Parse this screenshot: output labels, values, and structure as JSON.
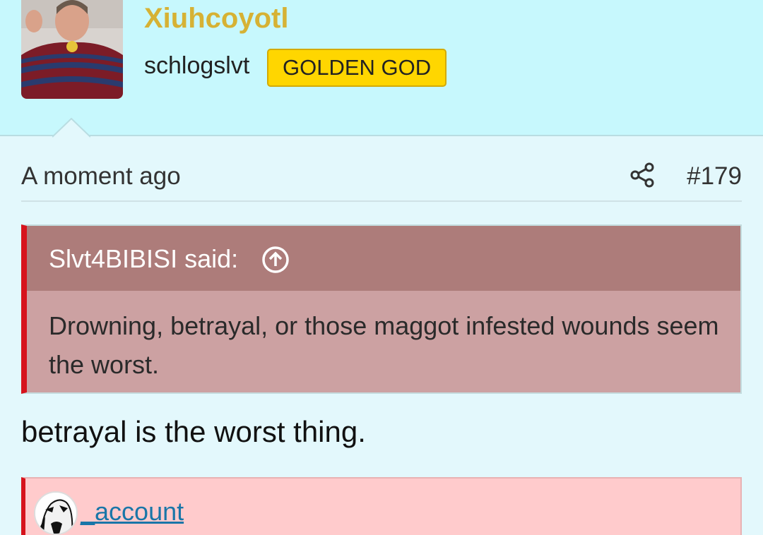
{
  "user": {
    "name": "Xiuhcoyotl",
    "title": "schlogslvt",
    "badge": "GOLDEN GOD",
    "colors": {
      "name": "#d6b234",
      "badge": "#ffd600",
      "header_bg": "#c7f8fd"
    }
  },
  "post": {
    "time": "A moment ago",
    "number": "#179",
    "share_icon": "share-icon",
    "body": "betrayal is the worst thing."
  },
  "quote": {
    "author_label": "Slvt4BIBISI said:",
    "jump_icon": "arrow-up-circle-icon",
    "text": "Drowning, betrayal, or those maggot infested wounds seem the worst.",
    "colors": {
      "border": "#d6131c",
      "head_bg": "#ad7c7a",
      "body_bg": "#cca1a2"
    }
  },
  "signature": {
    "link": "_account",
    "colors": {
      "bg": "#ffcbcc"
    }
  }
}
